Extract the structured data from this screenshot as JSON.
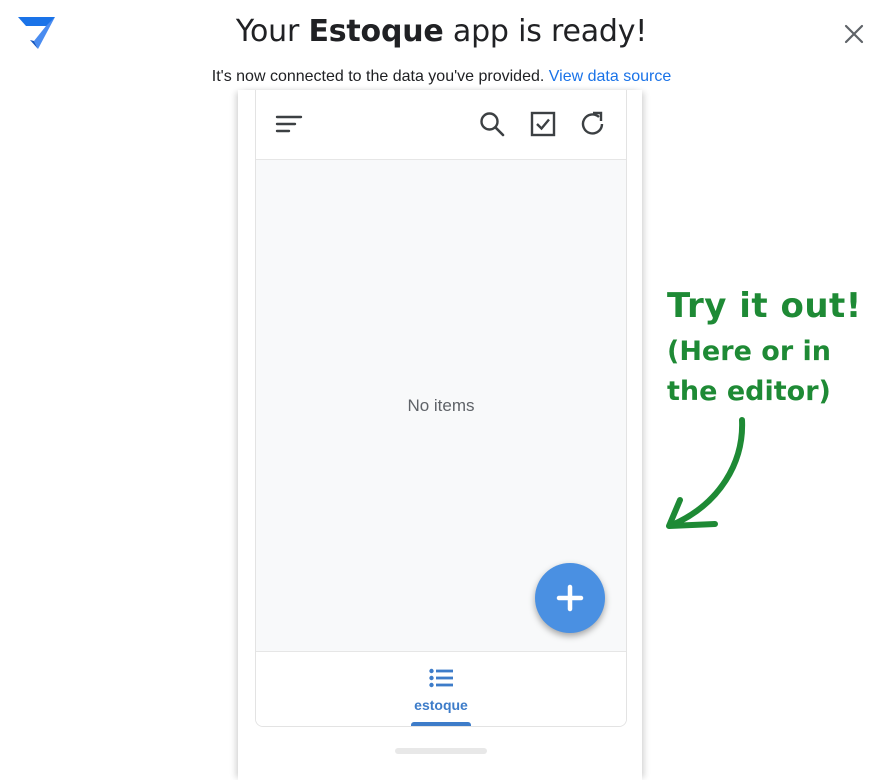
{
  "header": {
    "title_prefix": "Your",
    "app_name": "Estoque",
    "title_suffix": "app is ready!",
    "subtitle": "It's now connected to the data you've provided.",
    "view_data_link": "View data source"
  },
  "phone": {
    "toolbar_icons": [
      "menu-icon",
      "search-icon",
      "checkbox-icon",
      "refresh-icon"
    ],
    "empty_text": "No items",
    "fab_icon": "plus-icon",
    "bottom_nav": [
      {
        "label": "estoque",
        "icon": "list-icon",
        "selected": true
      }
    ]
  },
  "callout": {
    "line1": "Try it out!",
    "line2": "(Here or in",
    "line3": "the editor)"
  },
  "colors": {
    "brand_blue": "#1a73e8",
    "fab": "#4a90e2",
    "nav_accent": "#3d7cc9",
    "callout_green": "#1e8a35"
  }
}
